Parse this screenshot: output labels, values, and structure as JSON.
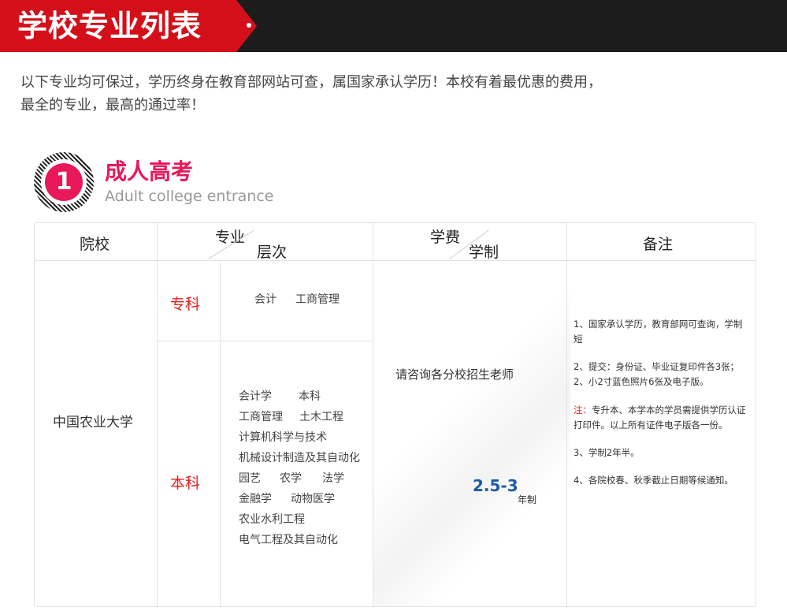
{
  "banner": {
    "title": "学校专业列表"
  },
  "intro": {
    "line1": "以下专业均可保过，学历终身在教育部网站可查，属国家承认学历！本校有着最优惠的费用，",
    "line2": "最全的专业，最高的通过率！"
  },
  "section": {
    "number": "1",
    "title": "成人高考",
    "subtitle": "Adult college entrance"
  },
  "table": {
    "headers": {
      "school": "院校",
      "major_top": "专业",
      "major_bottom": "层次",
      "fee_top": "学费",
      "fee_bottom": "学制",
      "remarks": "备注"
    },
    "school": "中国农业大学",
    "levels": [
      {
        "label": "专科",
        "majors": [
          "会计",
          "工商管理"
        ]
      },
      {
        "label": "本科",
        "majors": [
          [
            "会计学",
            "本科"
          ],
          [
            "工商管理",
            "土木工程"
          ],
          [
            "计算机科学与技术"
          ],
          [
            "机械设计制造及其自动化"
          ],
          [
            "园艺",
            "农学",
            "法学"
          ],
          [
            "金融学",
            "动物医学"
          ],
          [
            "农业水利工程"
          ],
          [
            "电气工程及其自动化"
          ]
        ]
      }
    ],
    "fee": {
      "text": "请咨询各分校招生老师",
      "duration": "2.5-3",
      "duration_unit": "年制"
    },
    "remarks": {
      "n1": "1、国家承认学历，教育部网可查询，学制短",
      "n2": "2、提交：身份证、毕业证复印件各3张；2、小2寸蓝色照片6张及电子版。",
      "n3_label": "注：",
      "n3": "专升本、本学本的学员需提供学历认证打印件。以上所有证件电子版各一份。",
      "n4": "3、学制2年半。",
      "n5": "4、各院校春、秋季截止日期等候通知。"
    }
  }
}
